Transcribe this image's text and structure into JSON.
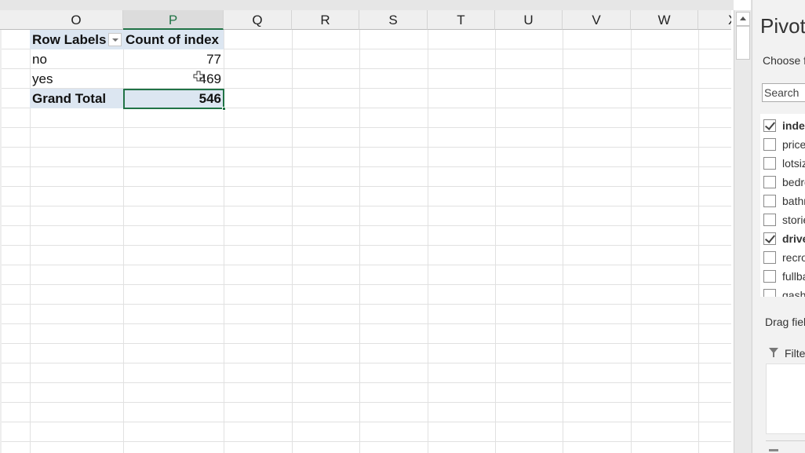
{
  "sheet": {
    "columns": [
      "O",
      "P",
      "Q",
      "R",
      "S",
      "T",
      "U",
      "V",
      "W",
      "X"
    ],
    "selected_column": "P",
    "pivot": {
      "header": {
        "row_labels": "Row Labels",
        "value_header": "Count of index"
      },
      "rows": [
        {
          "label": "no",
          "value": "77"
        },
        {
          "label": "yes",
          "value": "469"
        }
      ],
      "total": {
        "label": "Grand Total",
        "value": "546"
      }
    }
  },
  "pivot_panel": {
    "title": "PivotTable Fields",
    "choose_label": "Choose fields to add to report:",
    "search_placeholder": "Search",
    "fields": [
      {
        "name": "index",
        "checked": true
      },
      {
        "name": "price",
        "checked": false
      },
      {
        "name": "lotsize",
        "checked": false
      },
      {
        "name": "bedrooms",
        "checked": false
      },
      {
        "name": "bathrms",
        "checked": false
      },
      {
        "name": "stories",
        "checked": false
      },
      {
        "name": "driveway",
        "checked": true
      },
      {
        "name": "recroom",
        "checked": false
      },
      {
        "name": "fullbase",
        "checked": false
      },
      {
        "name": "gashw",
        "checked": false
      }
    ],
    "drag_label": "Drag fields between areas below:",
    "filters_label": "Filters"
  }
}
